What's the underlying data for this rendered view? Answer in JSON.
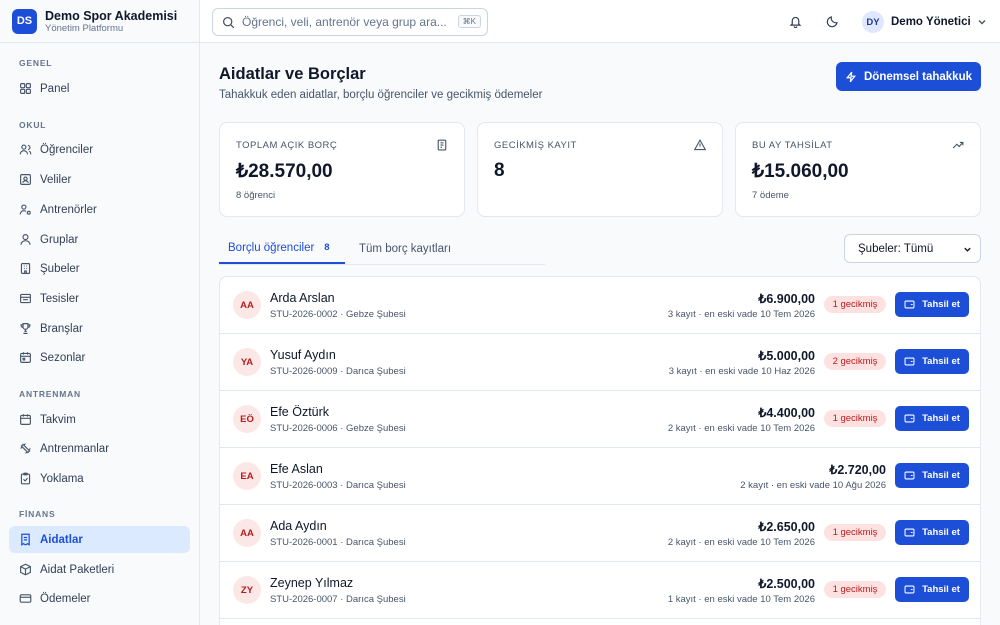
{
  "brand": {
    "logo": "DS",
    "name": "Demo Spor Akademisi",
    "subtitle": "Yönetim Platformu"
  },
  "sidebar": {
    "sections": [
      {
        "title": "GENEL",
        "items": [
          {
            "label": "Panel",
            "icon": "grid-icon"
          }
        ]
      },
      {
        "title": "OKUL",
        "items": [
          {
            "label": "Öğrenciler",
            "icon": "users-icon"
          },
          {
            "label": "Veliler",
            "icon": "contact-card-icon"
          },
          {
            "label": "Antrenörler",
            "icon": "user-cog-icon"
          },
          {
            "label": "Gruplar",
            "icon": "group-icon"
          },
          {
            "label": "Şubeler",
            "icon": "building-icon"
          },
          {
            "label": "Tesisler",
            "icon": "facility-icon"
          },
          {
            "label": "Branşlar",
            "icon": "trophy-icon"
          },
          {
            "label": "Sezonlar",
            "icon": "calendar-icon"
          }
        ]
      },
      {
        "title": "ANTRENMAN",
        "items": [
          {
            "label": "Takvim",
            "icon": "calendar-icon"
          },
          {
            "label": "Antrenmanlar",
            "icon": "workout-icon"
          },
          {
            "label": "Yoklama",
            "icon": "clipboard-check-icon"
          }
        ]
      },
      {
        "title": "FİNANS",
        "items": [
          {
            "label": "Aidatlar",
            "icon": "receipt-icon",
            "active": true
          },
          {
            "label": "Aidat Paketleri",
            "icon": "package-icon"
          },
          {
            "label": "Ödemeler",
            "icon": "credit-card-icon"
          }
        ]
      }
    ]
  },
  "topbar": {
    "search_placeholder": "Öğrenci, veli, antrenör veya grup ara...",
    "search_shortcut": "⌘K",
    "user_initials": "DY",
    "user_name": "Demo Yönetici"
  },
  "page": {
    "title": "Aidatlar ve Borçlar",
    "subtitle": "Tahakkuk eden aidatlar, borçlu öğrenciler ve gecikmiş ödemeler",
    "primary_action": "Dönemsel tahakkuk"
  },
  "stats": [
    {
      "label": "TOPLAM AÇIK BORÇ",
      "value": "₺28.570,00",
      "footnote": "8 öğrenci",
      "icon": "receipt-icon"
    },
    {
      "label": "GECİKMİŞ KAYIT",
      "value": "8",
      "footnote": "",
      "icon": "warning-icon"
    },
    {
      "label": "BU AY TAHSİLAT",
      "value": "₺15.060,00",
      "footnote": "7 ödeme",
      "icon": "trending-up-icon"
    }
  ],
  "tabs": [
    {
      "label": "Borçlu öğrenciler",
      "count": "8",
      "active": true
    },
    {
      "label": "Tüm borç kayıtları",
      "count": "",
      "active": false
    }
  ],
  "branch_filter": {
    "selected": "Şubeler: Tümü"
  },
  "debtors": [
    {
      "initials": "AA",
      "name": "Arda Arslan",
      "meta": "STU-2026-0002 · Gebze Şubesi",
      "amount": "₺6.900,00",
      "detail": "3 kayıt · en eski vade 10 Tem 2026",
      "overdue": "1 gecikmiş",
      "action": "Tahsil et"
    },
    {
      "initials": "YA",
      "name": "Yusuf Aydın",
      "meta": "STU-2026-0009 · Darıca Şubesi",
      "amount": "₺5.000,00",
      "detail": "3 kayıt · en eski vade 10 Haz 2026",
      "overdue": "2 gecikmiş",
      "action": "Tahsil et"
    },
    {
      "initials": "EÖ",
      "name": "Efe Öztürk",
      "meta": "STU-2026-0006 · Gebze Şubesi",
      "amount": "₺4.400,00",
      "detail": "2 kayıt · en eski vade 10 Tem 2026",
      "overdue": "1 gecikmiş",
      "action": "Tahsil et"
    },
    {
      "initials": "EA",
      "name": "Efe Aslan",
      "meta": "STU-2026-0003 · Darıca Şubesi",
      "amount": "₺2.720,00",
      "detail": "2 kayıt · en eski vade 10 Ağu 2026",
      "overdue": "",
      "action": "Tahsil et"
    },
    {
      "initials": "AA",
      "name": "Ada Aydın",
      "meta": "STU-2026-0001 · Darıca Şubesi",
      "amount": "₺2.650,00",
      "detail": "2 kayıt · en eski vade 10 Tem 2026",
      "overdue": "1 gecikmiş",
      "action": "Tahsil et"
    },
    {
      "initials": "ZY",
      "name": "Zeynep Yılmaz",
      "meta": "STU-2026-0007 · Darıca Şubesi",
      "amount": "₺2.500,00",
      "detail": "1 kayıt · en eski vade 10 Tem 2026",
      "overdue": "1 gecikmiş",
      "action": "Tahsil et"
    }
  ],
  "colors": {
    "accent": "#1d4ed8",
    "badge_bg": "#fee2e2",
    "badge_text": "#b91c1c"
  }
}
